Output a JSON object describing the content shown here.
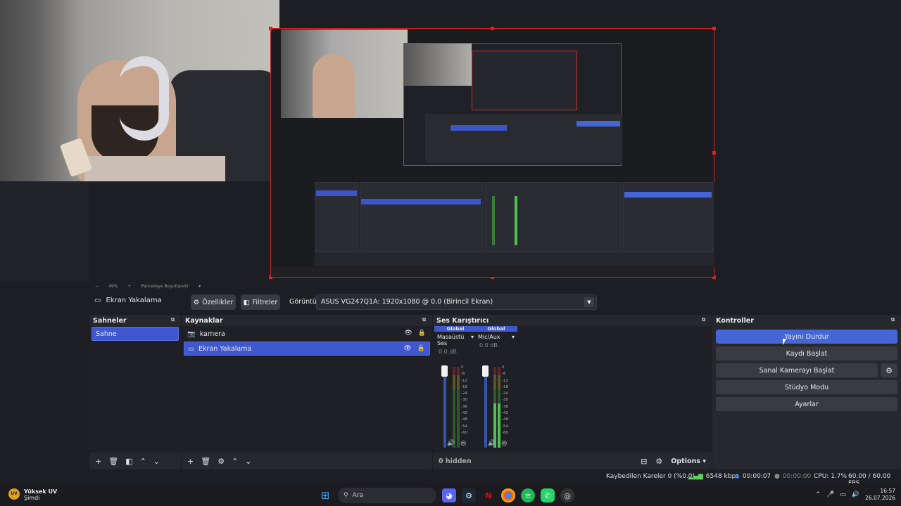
{
  "window": {
    "minimize": "─",
    "restore": "❐",
    "close": "✕"
  },
  "zoom": {
    "minus": "−",
    "level": "49%",
    "plus": "+",
    "fit_label": "Pencereye Boyutlandır"
  },
  "source_toolbar": {
    "source_name": "Ekran Yakalama",
    "properties_label": "Özellikler",
    "filters_label": "Filtreler",
    "display_label": "Görüntü",
    "display_value": "ASUS VG247Q1A: 1920x1080 @ 0,0 (Birincil Ekran)"
  },
  "scenes": {
    "title": "Sahneler",
    "items": [
      {
        "label": "Sahne"
      }
    ]
  },
  "sources": {
    "title": "Kaynaklar",
    "items": [
      {
        "label": "kamera",
        "selected": false
      },
      {
        "label": "Ekran Yakalama",
        "selected": true
      }
    ]
  },
  "mixer": {
    "title": "Ses Karıştırıcı",
    "channels": [
      {
        "badge": "Global",
        "name": "Masaüstü Ses",
        "db": "0.0 dB"
      },
      {
        "badge": "Global",
        "name": "Mic/Aux",
        "db": "0.0 dB"
      }
    ],
    "scale": [
      "0",
      "-6",
      "-12",
      "-18",
      "-24",
      "-30",
      "-36",
      "-42",
      "-48",
      "-54",
      "-60"
    ],
    "hidden_label": "0 hidden",
    "options_label": "Options"
  },
  "controls": {
    "title": "Kontroller",
    "stop_stream": "Yayını Durdur",
    "start_record": "Kaydı Başlat",
    "virtual_cam": "Sanal Kamerayı Başlat",
    "studio_mode": "Stüdyo Modu",
    "settings": "Ayarlar"
  },
  "status": {
    "dropped": "Kaybedilen Kareler 0 (%0.0)",
    "bitrate": "6548 kbps",
    "stream_time": "00:00:07",
    "rec_time": "00:00:00",
    "cpu": "CPU: 1.7%",
    "fps": "60.00 / 60.00 FPS"
  },
  "taskbar": {
    "weather_badge": "UV",
    "weather_title": "Yüksek UV",
    "weather_sub": "Şimdi",
    "search_placeholder": "Ara",
    "time": "16:57",
    "date": "26.07.2026",
    "accent": "#4466d6"
  }
}
